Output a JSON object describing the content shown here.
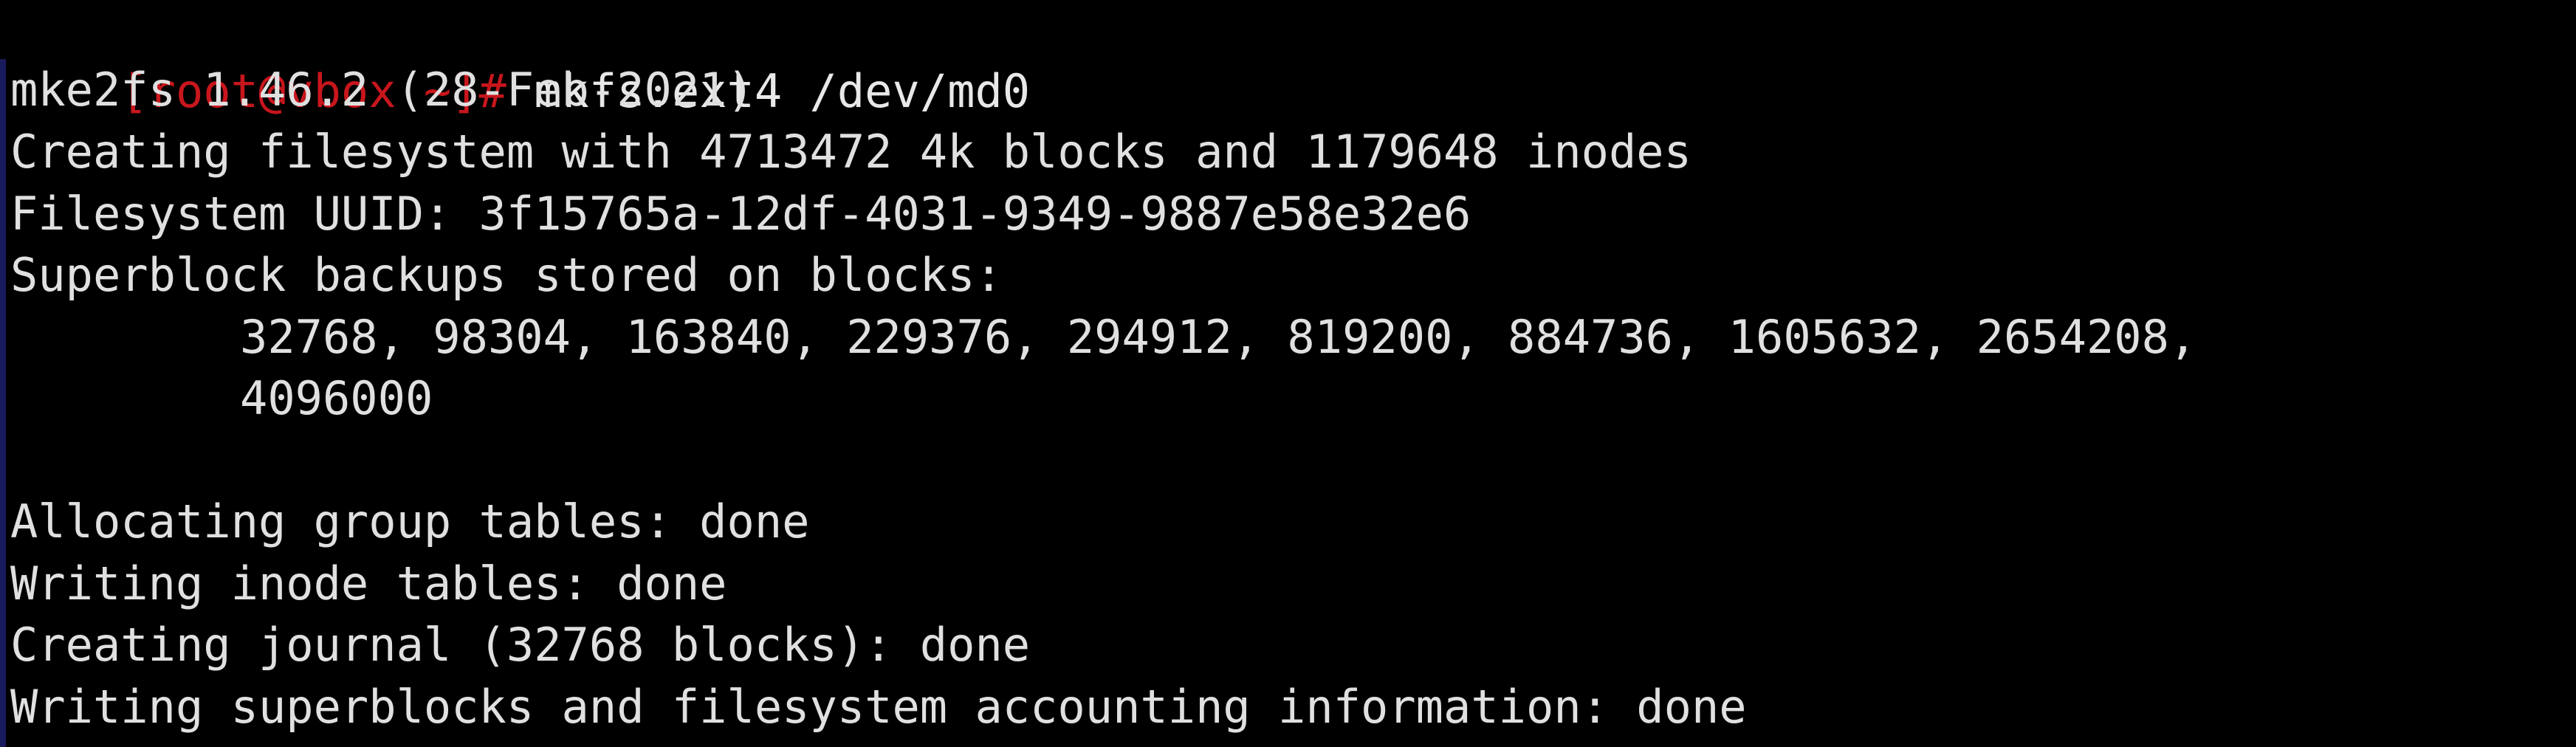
{
  "terminal": {
    "prompt": "[root@vbox ~]#",
    "command": "mkfs.ext4 /dev/md0",
    "colors": {
      "background": "#000000",
      "prompt": "#c8161d",
      "text": "#e0e0e0"
    },
    "output": {
      "version": "mke2fs 1.46.2 (28-Feb-2021)",
      "creating": "Creating filesystem with 4713472 4k blocks and 1179648 inodes",
      "uuid": "Filesystem UUID: 3f15765a-12df-4031-9349-9887e58e32e6",
      "backups_header": "Superblock backups stored on blocks:",
      "backups_line1": "32768, 98304, 163840, 229376, 294912, 819200, 884736, 1605632, 2654208,",
      "backups_line2": "4096000",
      "allocating": "Allocating group tables: done",
      "inode_tables": "Writing inode tables: done",
      "journal": "Creating journal (32768 blocks): done",
      "superblocks": "Writing superblocks and filesystem accounting information: done"
    }
  }
}
